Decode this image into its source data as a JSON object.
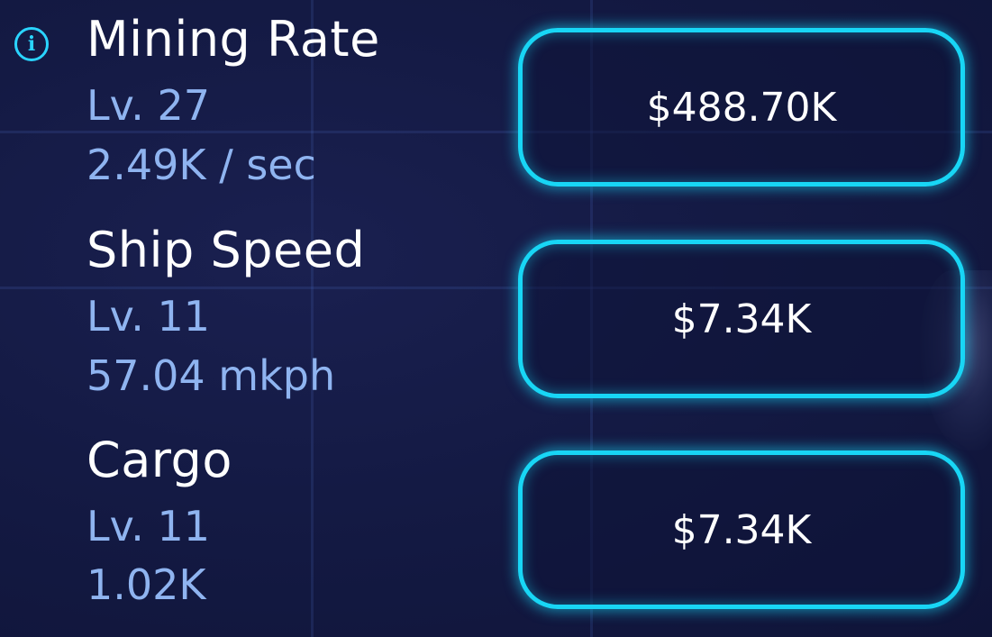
{
  "upgrades": [
    {
      "name": "Mining Rate",
      "level": "Lv. 27",
      "stat": "2.49K / sec",
      "cost": "$488.70K"
    },
    {
      "name": "Ship Speed",
      "level": "Lv. 11",
      "stat": "57.04 mkph",
      "cost": "$7.34K"
    },
    {
      "name": "Cargo",
      "level": "Lv. 11",
      "stat": "1.02K",
      "cost": "$7.34K"
    }
  ],
  "icons": {
    "info": "info-icon"
  },
  "colors": {
    "accent": "#18d6f5",
    "subtext": "#8fb4f0",
    "background": "#141a44"
  }
}
